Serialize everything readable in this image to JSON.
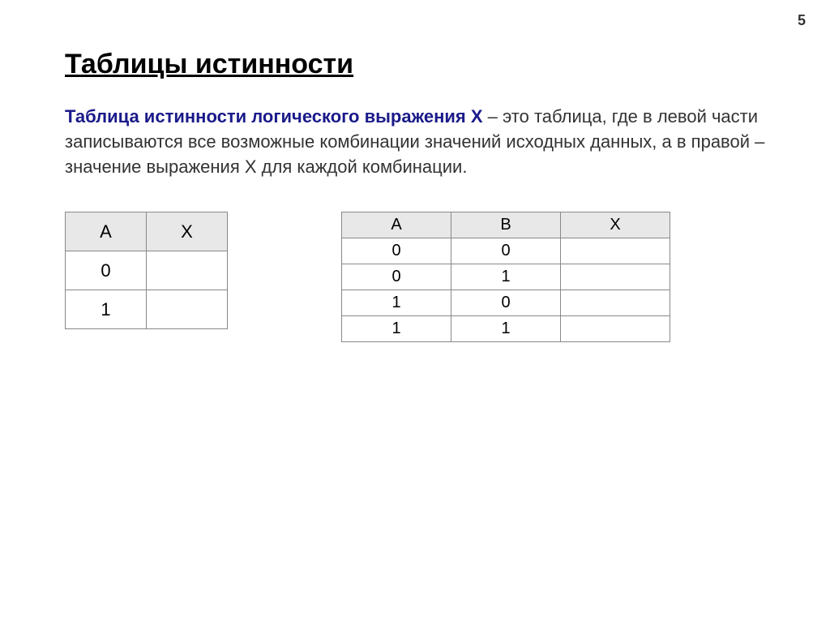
{
  "page_number": "5",
  "title": "Таблицы истинности",
  "description": {
    "highlight": "Таблица истинности логического выражения Х",
    "rest": " – это таблица, где в левой части записываются все возможные комбинации значений исходных данных, а в правой – значение выражения Х для каждой комбинации."
  },
  "table1": {
    "headers": [
      "A",
      "X"
    ],
    "rows": [
      [
        "0",
        ""
      ],
      [
        "1",
        ""
      ]
    ]
  },
  "table2": {
    "headers": [
      "A",
      "B",
      "X"
    ],
    "rows": [
      [
        "0",
        "0",
        ""
      ],
      [
        "0",
        "1",
        ""
      ],
      [
        "1",
        "0",
        ""
      ],
      [
        "1",
        "1",
        ""
      ]
    ]
  }
}
